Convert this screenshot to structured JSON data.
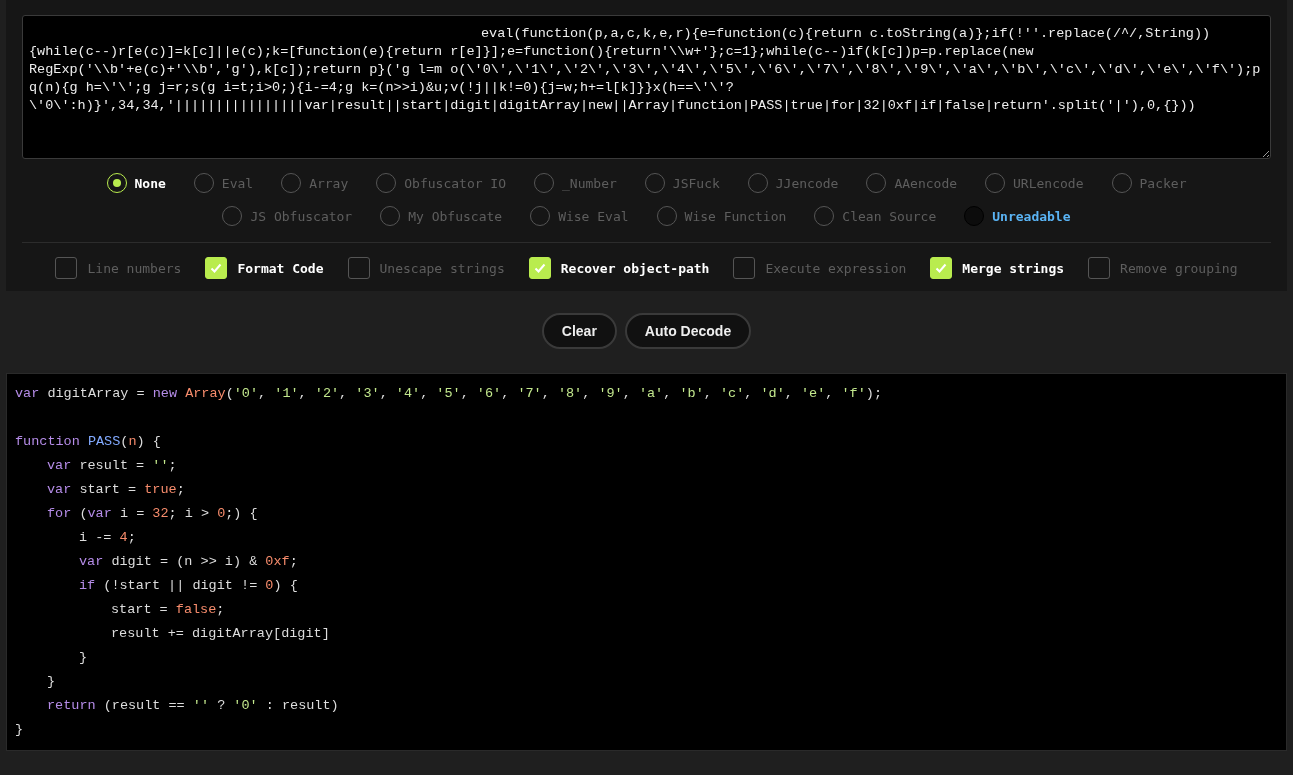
{
  "input": {
    "value": "eval(function(p,a,c,k,e,r){e=function(c){return c.toString(a)};if(!''.replace(/^/,String))\n{while(c--)r[e(c)]=k[c]||e(c);k=[function(e){return r[e]}];e=function(){return'\\\\w+'};c=1};while(c--)if(k[c])p=p.replace(new\nRegExp('\\\\b'+e(c)+'\\\\b','g'),k[c]);return p}('g l=m o(\\'0\\',\\'1\\',\\'2\\',\\'3\\',\\'4\\',\\'5\\',\\'6\\',\\'7\\',\\'8\\',\\'9\\',\\'a\\',\\'b\\',\\'c\\',\\'d\\',\\'e\\',\\'f\\');p\nq(n){g h=\\'\\';g j=r;s(g i=t;i>0;){i-=4;g k=(n>>i)&u;v(!j||k!=0){j=w;h+=l[k]}}x(h==\\'\\'?\n\\'0\\':h)}',34,34,'||||||||||||||||var|result||start|digit|digitArray|new||Array|function|PASS|true|for|32|0xf|if|false|return'.split('|'),0,{}))"
  },
  "decoders": [
    [
      {
        "label": "None",
        "selected": true,
        "highlighted": false
      },
      {
        "label": "Eval",
        "selected": false,
        "highlighted": false
      },
      {
        "label": "Array",
        "selected": false,
        "highlighted": false
      },
      {
        "label": "Obfuscator IO",
        "selected": false,
        "highlighted": false
      },
      {
        "label": "_Number",
        "selected": false,
        "highlighted": false
      },
      {
        "label": "JSFuck",
        "selected": false,
        "highlighted": false
      },
      {
        "label": "JJencode",
        "selected": false,
        "highlighted": false
      },
      {
        "label": "AAencode",
        "selected": false,
        "highlighted": false
      },
      {
        "label": "URLencode",
        "selected": false,
        "highlighted": false
      },
      {
        "label": "Packer",
        "selected": false,
        "highlighted": false
      }
    ],
    [
      {
        "label": "JS Obfuscator",
        "selected": false,
        "highlighted": false
      },
      {
        "label": "My Obfuscate",
        "selected": false,
        "highlighted": false
      },
      {
        "label": "Wise Eval",
        "selected": false,
        "highlighted": false
      },
      {
        "label": "Wise Function",
        "selected": false,
        "highlighted": false
      },
      {
        "label": "Clean Source",
        "selected": false,
        "highlighted": false
      },
      {
        "label": "Unreadable",
        "selected": false,
        "highlighted": true
      }
    ]
  ],
  "options": [
    {
      "label": "Line numbers",
      "checked": false
    },
    {
      "label": "Format Code",
      "checked": true
    },
    {
      "label": "Unescape strings",
      "checked": false
    },
    {
      "label": "Recover object-path",
      "checked": true
    },
    {
      "label": "Execute expression",
      "checked": false
    },
    {
      "label": "Merge strings",
      "checked": true
    },
    {
      "label": "Remove grouping",
      "checked": false
    }
  ],
  "buttons": [
    "Clear",
    "Auto Decode"
  ],
  "output": [
    {
      "tokens": [
        {
          "text": "var",
          "kind": "keyword"
        },
        {
          "text": " digitArray = ",
          "kind": "plain"
        },
        {
          "text": "new ",
          "kind": "keyword"
        },
        {
          "text": "Array",
          "kind": "number"
        },
        {
          "text": "(",
          "kind": "plain"
        },
        {
          "text": "'0'",
          "kind": "string"
        },
        {
          "text": ", ",
          "kind": "plain"
        },
        {
          "text": "'1'",
          "kind": "string"
        },
        {
          "text": ", ",
          "kind": "plain"
        },
        {
          "text": "'2'",
          "kind": "string"
        },
        {
          "text": ", ",
          "kind": "plain"
        },
        {
          "text": "'3'",
          "kind": "string"
        },
        {
          "text": ", ",
          "kind": "plain"
        },
        {
          "text": "'4'",
          "kind": "string"
        },
        {
          "text": ", ",
          "kind": "plain"
        },
        {
          "text": "'5'",
          "kind": "string"
        },
        {
          "text": ", ",
          "kind": "plain"
        },
        {
          "text": "'6'",
          "kind": "string"
        },
        {
          "text": ", ",
          "kind": "plain"
        },
        {
          "text": "'7'",
          "kind": "string"
        },
        {
          "text": ", ",
          "kind": "plain"
        },
        {
          "text": "'8'",
          "kind": "string"
        },
        {
          "text": ", ",
          "kind": "plain"
        },
        {
          "text": "'9'",
          "kind": "string"
        },
        {
          "text": ", ",
          "kind": "plain"
        },
        {
          "text": "'a'",
          "kind": "string"
        },
        {
          "text": ", ",
          "kind": "plain"
        },
        {
          "text": "'b'",
          "kind": "string"
        },
        {
          "text": ", ",
          "kind": "plain"
        },
        {
          "text": "'c'",
          "kind": "string"
        },
        {
          "text": ", ",
          "kind": "plain"
        },
        {
          "text": "'d'",
          "kind": "string"
        },
        {
          "text": ", ",
          "kind": "plain"
        },
        {
          "text": "'e'",
          "kind": "string"
        },
        {
          "text": ", ",
          "kind": "plain"
        },
        {
          "text": "'f'",
          "kind": "string"
        },
        {
          "text": ");",
          "kind": "plain"
        }
      ]
    },
    {
      "tokens": [
        {
          "text": "function ",
          "kind": "keyword"
        },
        {
          "text": "PASS",
          "kind": "function"
        },
        {
          "text": "(",
          "kind": "plain"
        },
        {
          "text": "n",
          "kind": "number"
        },
        {
          "text": ") {",
          "kind": "plain"
        }
      ],
      "children": [
        {
          "tokens": [
            {
              "text": "var",
              "kind": "keyword"
            },
            {
              "text": " result = ",
              "kind": "plain"
            },
            {
              "text": "''",
              "kind": "string"
            },
            {
              "text": ";",
              "kind": "plain"
            }
          ]
        },
        {
          "tokens": [
            {
              "text": "var",
              "kind": "keyword"
            },
            {
              "text": " start = ",
              "kind": "plain"
            },
            {
              "text": "true",
              "kind": "number"
            },
            {
              "text": ";",
              "kind": "plain"
            }
          ]
        },
        {
          "tokens": [
            {
              "text": "for",
              "kind": "keyword"
            },
            {
              "text": " (",
              "kind": "plain"
            },
            {
              "text": "var",
              "kind": "keyword"
            },
            {
              "text": " i = ",
              "kind": "plain"
            },
            {
              "text": "32",
              "kind": "number"
            },
            {
              "text": "; i > ",
              "kind": "plain"
            },
            {
              "text": "0",
              "kind": "number"
            },
            {
              "text": ";) {",
              "kind": "plain"
            }
          ],
          "children": [
            {
              "tokens": [
                {
                  "text": "i -= ",
                  "kind": "plain"
                },
                {
                  "text": "4",
                  "kind": "number"
                },
                {
                  "text": ";",
                  "kind": "plain"
                }
              ]
            },
            {
              "tokens": [
                {
                  "text": "var",
                  "kind": "keyword"
                },
                {
                  "text": " digit = (n >> i) & ",
                  "kind": "plain"
                },
                {
                  "text": "0xf",
                  "kind": "number"
                },
                {
                  "text": ";",
                  "kind": "plain"
                }
              ]
            },
            {
              "tokens": [
                {
                  "text": "if",
                  "kind": "keyword"
                },
                {
                  "text": " (!start || digit != ",
                  "kind": "plain"
                },
                {
                  "text": "0",
                  "kind": "number"
                },
                {
                  "text": ") {",
                  "kind": "plain"
                }
              ],
              "children": [
                {
                  "tokens": [
                    {
                      "text": "start = ",
                      "kind": "plain"
                    },
                    {
                      "text": "false",
                      "kind": "number"
                    },
                    {
                      "text": ";",
                      "kind": "plain"
                    }
                  ]
                },
                {
                  "tokens": [
                    {
                      "text": "result += digitArray[digit]",
                      "kind": "plain"
                    }
                  ]
                }
              ]
            },
            {
              "tokens": [
                {
                  "text": "}",
                  "kind": "plain"
                }
              ]
            }
          ]
        },
        {
          "tokens": [
            {
              "text": "}",
              "kind": "plain"
            }
          ]
        },
        {
          "tokens": [
            {
              "text": "return",
              "kind": "keyword"
            },
            {
              "text": " (result == ",
              "kind": "plain"
            },
            {
              "text": "''",
              "kind": "string"
            },
            {
              "text": " ? ",
              "kind": "plain"
            },
            {
              "text": "'0'",
              "kind": "string"
            },
            {
              "text": " : result)",
              "kind": "plain"
            }
          ]
        }
      ]
    },
    {
      "tokens": [
        {
          "text": "}",
          "kind": "plain"
        }
      ]
    }
  ]
}
